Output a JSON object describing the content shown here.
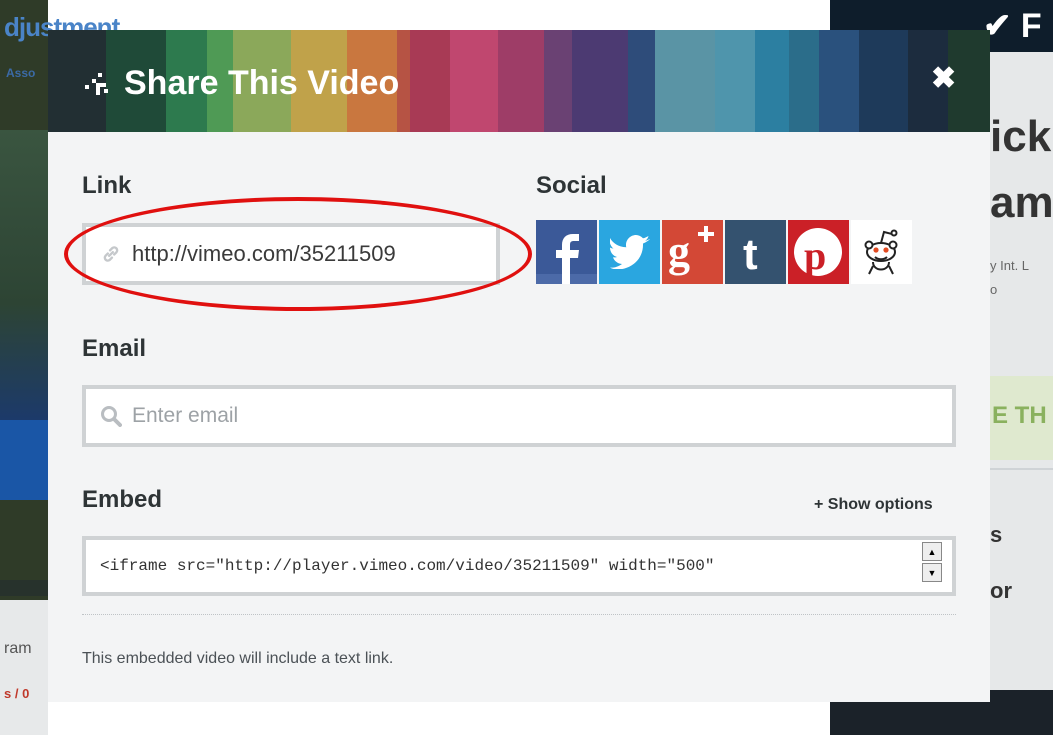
{
  "background": {
    "left_title": "djustment",
    "left_subtitle": "Asso",
    "left_text_1": "ram",
    "left_text_2": "s / 0",
    "right_big_1": "ick",
    "right_big_2": "am",
    "right_small_1": "y Int. L",
    "right_small_2": "o",
    "right_green": "E TH",
    "right_heading_1": "s",
    "right_heading_2": "or",
    "right_check": "✔ F"
  },
  "modal": {
    "title": "Share This Video",
    "close_label": "✖",
    "header_colors": [
      "#222f33",
      "#1f4a38",
      "#2d7a4e",
      "#4f9a55",
      "#8ba85a",
      "#c0a24a",
      "#c9773f",
      "#b65344",
      "#a83a55",
      "#c0476f",
      "#9e3d67",
      "#6a4173",
      "#4c3a72",
      "#2e4c7a",
      "#5a94a5",
      "#4f95ac",
      "#2c7fa1",
      "#2b6d8a",
      "#2a517d",
      "#1e3a5a",
      "#1c2c3e",
      "#1f3a2e"
    ],
    "link": {
      "label": "Link",
      "value": "http://vimeo.com/35211509",
      "icon": "chain-link-icon"
    },
    "social": {
      "label": "Social",
      "networks": [
        {
          "name": "facebook",
          "glyph": "f",
          "color": "#3b5998"
        },
        {
          "name": "twitter",
          "glyph": "t-bird",
          "color": "#2aa6e0"
        },
        {
          "name": "google-plus",
          "glyph": "g+",
          "color": "#d34836"
        },
        {
          "name": "tumblr",
          "glyph": "t",
          "color": "#34526f"
        },
        {
          "name": "pinterest",
          "glyph": "p",
          "color": "#cb2027"
        },
        {
          "name": "reddit",
          "glyph": "alien",
          "color": "#ffffff"
        }
      ]
    },
    "email": {
      "label": "Email",
      "placeholder": "Enter email",
      "icon": "search-icon"
    },
    "embed": {
      "label": "Embed",
      "show_options": "+ Show options",
      "code": "<iframe src=\"http://player.vimeo.com/video/35211509\" width=\"500\"",
      "note": "This embedded video will include a text link."
    },
    "annotation_color": "#e0100f"
  }
}
